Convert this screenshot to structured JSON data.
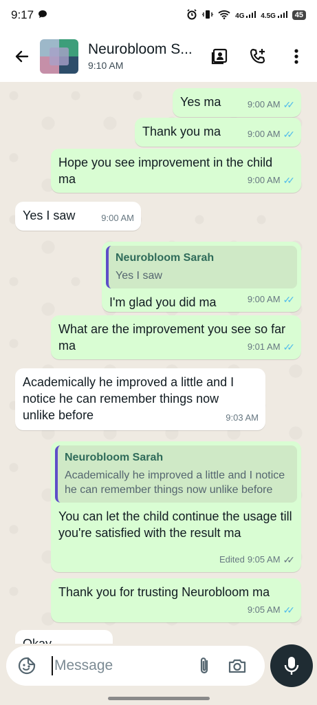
{
  "status_bar": {
    "time": "9:17",
    "net_4g": "4G",
    "net_45g": "4.5G",
    "battery": "45"
  },
  "header": {
    "name": "Neurobloom S...",
    "subtitle": "9:10 AM"
  },
  "messages": [
    {
      "text": "Yes ma",
      "time": "9:00 AM",
      "status": "read"
    },
    {
      "text": "Thank you ma",
      "time": "9:00 AM",
      "status": "read"
    },
    {
      "text": "Hope you see improvement in the child ma",
      "time": "9:00 AM",
      "status": "read"
    },
    {
      "text": "Yes I saw",
      "time": "9:00 AM"
    },
    {
      "quote_author": "Neurobloom Sarah",
      "quote_text": "Yes I saw",
      "text": "I'm glad you did ma",
      "time": "9:00 AM",
      "status": "read"
    },
    {
      "text": "What are the improvement you see so far ma",
      "time": "9:01 AM",
      "status": "read"
    },
    {
      "text": "Academically he improved a little and I notice  he can remember things now unlike before",
      "time": "9:03 AM"
    },
    {
      "quote_author": "Neurobloom Sarah",
      "quote_text": "Academically he improved a little and I notice  he can remember things now unlike before",
      "text": "You can let the child continue the usage till you're satisfied with the result ma",
      "edited": "Edited",
      "time": "9:05 AM",
      "status": "delivered"
    },
    {
      "text": "Thank you for trusting Neurobloom ma",
      "time": "9:05 AM",
      "status": "read"
    },
    {
      "text": "Okay"
    }
  ],
  "composer": {
    "placeholder": "Message"
  },
  "colors": {
    "outgoing_bubble": "#d9fdd3",
    "incoming_bubble": "#ffffff",
    "chat_background": "#efeae2",
    "read_tick": "#53bdeb"
  }
}
